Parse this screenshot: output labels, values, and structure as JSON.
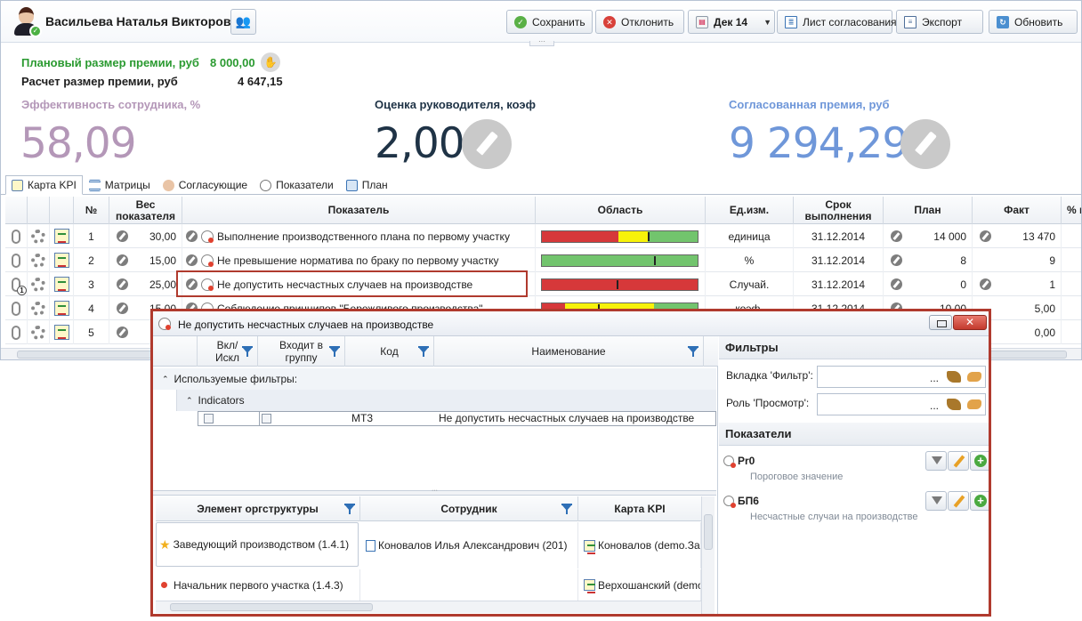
{
  "header": {
    "user_name": "Васильева Наталья Викторовна",
    "buttons": {
      "save": "Сохранить",
      "decline": "Отклонить",
      "period": "Дек 14",
      "approval_sheet": "Лист согласования",
      "export": "Экспорт",
      "refresh": "Обновить"
    }
  },
  "bonus": {
    "planned_label": "Плановый размер премии, руб",
    "planned_value": "8 000,00",
    "calc_label": "Расчет размер премии, руб",
    "calc_value": "4 647,15"
  },
  "kpis": {
    "efficiency_label": "Эффективность сотрудника, %",
    "efficiency_value": "58,09",
    "manager_label": "Оценка руководителя, коэф",
    "manager_value": "2,00",
    "agreed_label": "Согласованная премия, руб",
    "agreed_value": "9 294,29"
  },
  "colors": {
    "efficiency": "#b497b8",
    "manager": "#1f3346",
    "agreed": "#6f97d9",
    "planned": "#2a9a30",
    "accent_red": "#b03a2e"
  },
  "tabs": [
    {
      "label": "Карта KPI"
    },
    {
      "label": "Матрицы"
    },
    {
      "label": "Согласующие"
    },
    {
      "label": "Показатели"
    },
    {
      "label": "План"
    }
  ],
  "grid": {
    "columns": {
      "num": "№",
      "weight": "Вес показателя",
      "indicator": "Показатель",
      "area": "Область",
      "unit": "Ед.изм.",
      "deadline": "Срок выполнения",
      "plan": "План",
      "fact": "Факт",
      "pct": "% в"
    },
    "rows": [
      {
        "num": "1",
        "weight": "30,00",
        "indicator": "Выполнение производственного плана по первому участку",
        "unit": "единица",
        "deadline": "31.12.2014",
        "plan": "14 000",
        "fact": "13 470",
        "bar": [
          0.49,
          0.19,
          0.32
        ],
        "marker": 0.68
      },
      {
        "num": "2",
        "weight": "15,00",
        "indicator": "Не превышение норматива по браку по первому участку",
        "unit": "%",
        "deadline": "31.12.2014",
        "plan": "8",
        "fact": "9",
        "bar": [
          0,
          0,
          1
        ],
        "marker": 0.72
      },
      {
        "num": "3",
        "weight": "25,00",
        "indicator": "Не допустить несчастных случаев на производстве",
        "unit": "Случай.",
        "deadline": "31.12.2014",
        "plan": "0",
        "fact": "1",
        "bar": [
          1,
          0,
          0
        ],
        "marker": 0.48,
        "badge": "1"
      },
      {
        "num": "4",
        "weight": "15,00",
        "indicator": "Соблюдение принципов \"Бережливого производства\"",
        "unit": "коэф.",
        "deadline": "31.12.2014",
        "plan": "10,00",
        "fact": "5,00",
        "bar": [
          0.15,
          0.57,
          0.28
        ],
        "marker": 0.36
      },
      {
        "num": "5",
        "weight": "",
        "indicator": "",
        "unit": "",
        "deadline": "",
        "plan": "",
        "fact": "0,00",
        "bar": [
          0,
          0,
          0
        ],
        "marker": null
      }
    ]
  },
  "dialog": {
    "title": "Не допустить несчастных случаев на производстве",
    "filter_columns": {
      "incl": "Вкл/ Искл",
      "group": "Входит в группу",
      "code": "Код",
      "name": "Наименование"
    },
    "group_used": "Используемые фильтры:",
    "group_indicators": "Indicators",
    "filter_row": {
      "code": "МТ3",
      "name": "Не допустить несчастных случаев на производстве"
    },
    "org_columns": {
      "element": "Элемент оргструктуры",
      "employee": "Сотрудник",
      "kpi_card": "Карта KPI"
    },
    "org_rows": [
      {
        "element": "Заведующий производством (1.4.1)",
        "employee": "Коновалов Илья Александрович  (201)",
        "kpi_card": "Коновалов (demo.Зав"
      },
      {
        "element": "Начальник первого участка (1.4.3)",
        "employee": "",
        "kpi_card": "Верхошанский (demo"
      }
    ],
    "filters_title": "Фильтры",
    "filter_tab_label": "Вкладка 'Фильтр':",
    "filter_view_label": "Роль 'Просмотр':",
    "dots": "...",
    "indicators_title": "Показатели",
    "indicators": [
      {
        "name": "Pr0",
        "desc": "Пороговое значение"
      },
      {
        "name": "БП6",
        "desc": "Несчастные случаи на производстве"
      }
    ]
  }
}
